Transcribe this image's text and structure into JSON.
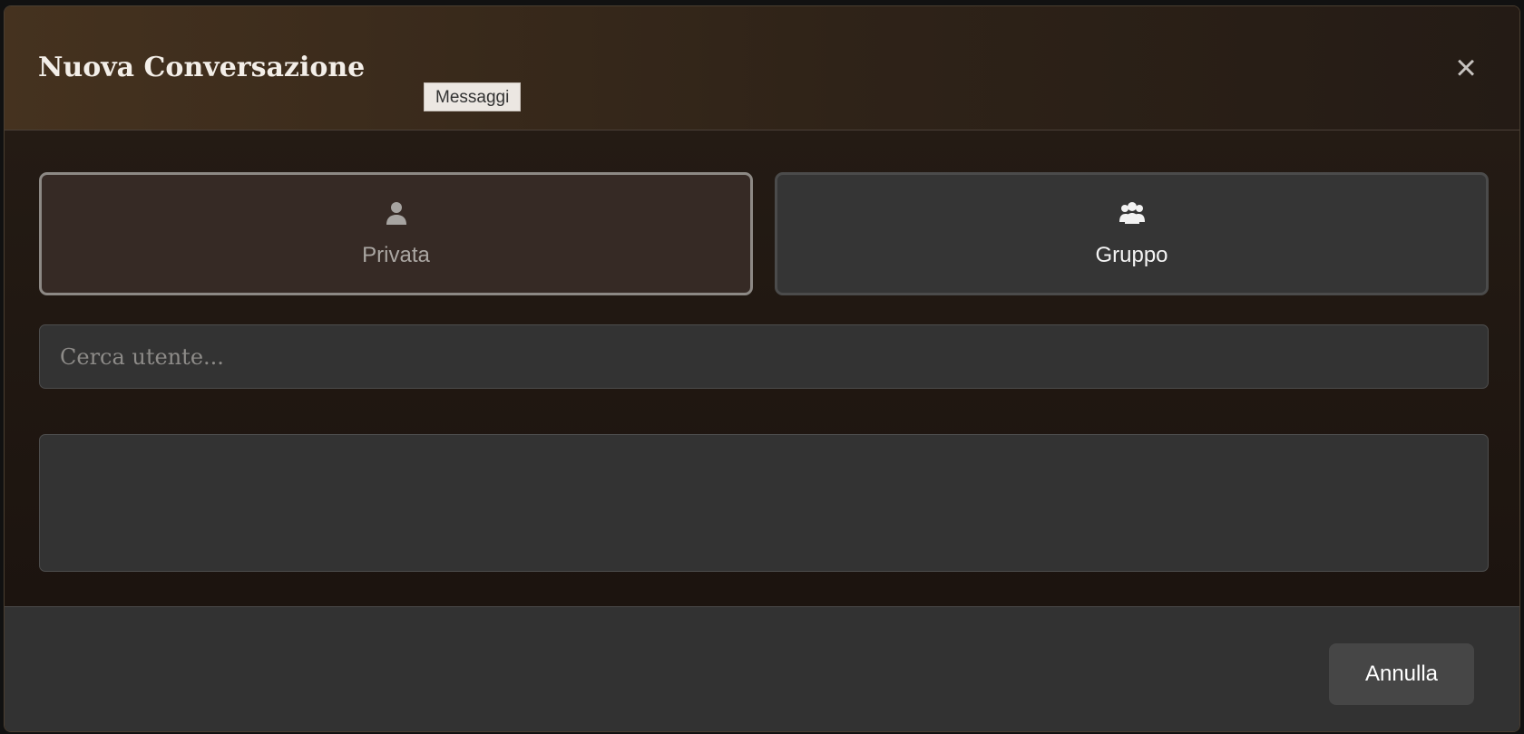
{
  "modal": {
    "title": "Nuova Conversazione",
    "tooltip": "Messaggi",
    "close_label": "×",
    "type_options": [
      {
        "label": "Privata",
        "icon": "person-icon",
        "selected": true
      },
      {
        "label": "Gruppo",
        "icon": "people-group-icon",
        "selected": false
      }
    ],
    "search": {
      "placeholder": "Cerca utente...",
      "value": ""
    },
    "footer": {
      "cancel_label": "Annulla"
    }
  }
}
